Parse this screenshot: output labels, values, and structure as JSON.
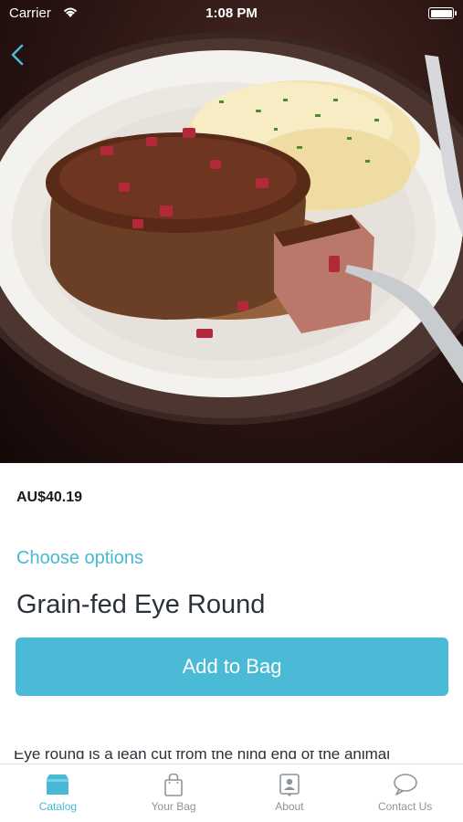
{
  "status_bar": {
    "carrier": "Carrier",
    "time": "1:08 PM"
  },
  "nav": {
    "back_icon": "chevron-left-icon"
  },
  "product": {
    "image_subject": "steak-dish-photo",
    "price": "AU$40.19",
    "choose_options": "Choose options",
    "name": "Grain-fed Eye Round",
    "add_button": "Add to Bag",
    "description": "Eye round is a lean cut from the hind end of the animal"
  },
  "tab_bar": {
    "items": [
      {
        "label": "Catalog",
        "icon": "catalog-icon",
        "active": true
      },
      {
        "label": "Your Bag",
        "icon": "bag-icon",
        "active": false
      },
      {
        "label": "About",
        "icon": "about-icon",
        "active": false
      },
      {
        "label": "Contact Us",
        "icon": "chat-icon",
        "active": false
      }
    ]
  },
  "colors": {
    "accent": "#48b9d4",
    "button": "#4bbad7",
    "inactive": "#8d949a"
  }
}
